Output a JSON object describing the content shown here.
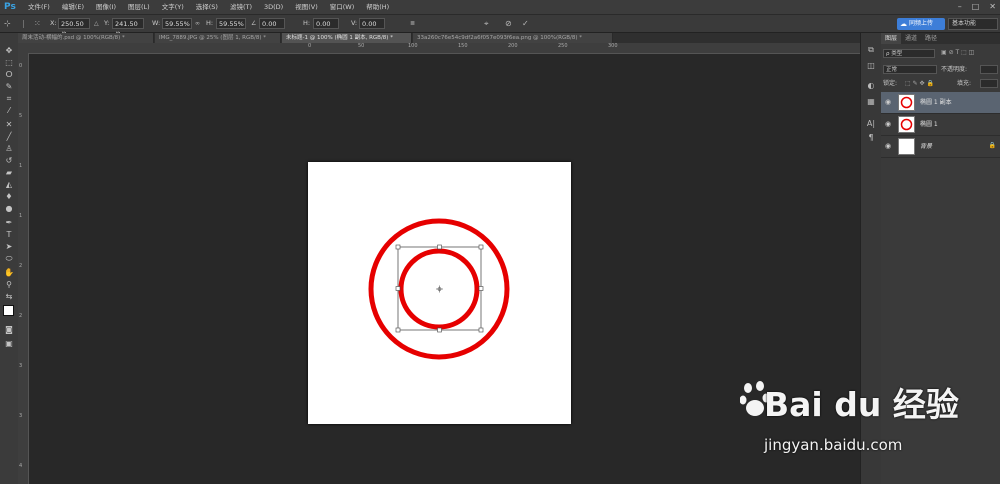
{
  "app": {
    "logo": "Ps"
  },
  "menu": [
    "文件(F)",
    "编辑(E)",
    "图像(I)",
    "图层(L)",
    "文字(Y)",
    "选择(S)",
    "滤镜(T)",
    "3D(D)",
    "视图(V)",
    "窗口(W)",
    "帮助(H)"
  ],
  "options": {
    "x_label": "X:",
    "x_value": "250.50 像",
    "y_label": "Y:",
    "y_value": "241.50 像",
    "w_label": "W:",
    "w_value": "59.55%",
    "h_label": "H:",
    "h_value": "59.55%",
    "angle_value": "0.00",
    "hskew_label": "H:",
    "hskew_value": "0.00",
    "vskew_label": "V:",
    "vskew_value": "0.00",
    "cloud_label": "同频上传",
    "workspace_label": "基本功能"
  },
  "tabs": [
    {
      "label": "周末活动-横幅的.psd @ 100%(RGB/8) *"
    },
    {
      "label": "IMG_7889.JPG @ 25% (图层 1, RGB/8) *"
    },
    {
      "label": "未标题-1 @ 100% (椭圆 1 副本, RGB/8) *"
    },
    {
      "label": "33a260c76e54c9df2a6f057e093f6ea.png @ 100%(RGB/8) *"
    }
  ],
  "layers_panel": {
    "tabs": [
      "图层",
      "通道",
      "路径"
    ],
    "filter_label": "ρ 类型",
    "blend_mode": "正常",
    "opacity_label": "不透明度:",
    "lock_label": "锁定:",
    "fill_label": "填充:",
    "layers": [
      {
        "name": "椭圆 1 副本"
      },
      {
        "name": "椭圆 1"
      },
      {
        "name": "背景"
      }
    ]
  },
  "ruler_h_labels": [
    "0",
    "50",
    "100",
    "150",
    "200",
    "250",
    "300"
  ],
  "ruler_v_labels": [
    "0",
    "5",
    "1",
    "1",
    "2",
    "2",
    "3",
    "3",
    "4"
  ],
  "watermark": {
    "brand": "Bai du 经验",
    "url": "jingyan.baidu.com"
  },
  "colors": {
    "accent": "#3aa3e3",
    "ring": "#e60000",
    "cloud": "#3d7ed8"
  }
}
